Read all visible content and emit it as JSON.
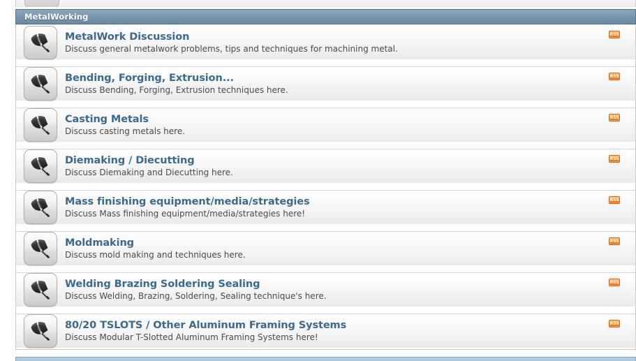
{
  "category": {
    "name": "MetalWorking",
    "header_color": "#7593ad",
    "title_color": "#3b6a8c",
    "rss_color": "#f58a22",
    "rss_label": "RSS",
    "icon_name": "forum-metalwork-icon"
  },
  "forums": [
    {
      "title": "MetalWork Discussion",
      "description": "Discuss general metalwork problems, tips and techniques for machining metal."
    },
    {
      "title": "Bending, Forging, Extrusion...",
      "description": "Discuss Bending, Forging, Extrusion techniques here."
    },
    {
      "title": "Casting Metals",
      "description": "Discuss casting metals here."
    },
    {
      "title": "Diemaking / Diecutting",
      "description": "Discuss Diemaking and Diecutting here."
    },
    {
      "title": "Mass finishing equipment/media/strategies",
      "description": "Discuss Mass finishing equipment/media/strategies here!"
    },
    {
      "title": "Moldmaking",
      "description": "Discuss mold making and techniques here."
    },
    {
      "title": "Welding Brazing Soldering Sealing",
      "description": "Discuss Welding, Brazing, Soldering, Sealing technique's here."
    },
    {
      "title": "80/20 TSLOTS / Other Aluminum Framing Systems",
      "description": "Discuss Modular T-Slotted Aluminum Framing Systems here!"
    }
  ]
}
